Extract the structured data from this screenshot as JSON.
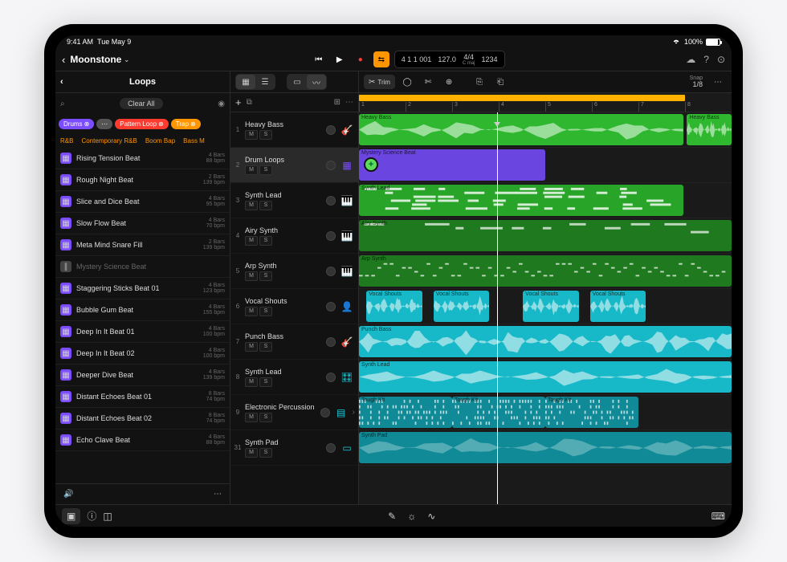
{
  "status": {
    "time": "9:41 AM",
    "date": "Tue May 9",
    "battery": "100%"
  },
  "project": {
    "title": "Moonstone"
  },
  "transport": {
    "position": "4 1 1 001",
    "tempo": "127.0",
    "signature": "4/4",
    "key": "C maj",
    "beat_count": "1234"
  },
  "snap": {
    "label": "Snap",
    "value": "1/8"
  },
  "sidebar": {
    "title": "Loops",
    "clear": "Clear All",
    "filters": [
      {
        "label": "Drums",
        "color": "#7c4dff"
      },
      {
        "label": "Pattern Loop",
        "color": "#ff3b30"
      },
      {
        "label": "Trap",
        "color": "#ff9500"
      }
    ],
    "genres": [
      "R&B",
      "Contemporary R&B",
      "Boom Bap",
      "Bass M"
    ],
    "loops": [
      {
        "name": "Rising Tension Beat",
        "bars": "4 Bars",
        "bpm": "88 bpm",
        "type": "purple"
      },
      {
        "name": "Rough Night Beat",
        "bars": "2 Bars",
        "bpm": "139 bpm",
        "type": "purple"
      },
      {
        "name": "Slice and Dice Beat",
        "bars": "4 Bars",
        "bpm": "95 bpm",
        "type": "purple"
      },
      {
        "name": "Slow Flow Beat",
        "bars": "4 Bars",
        "bpm": "70 bpm",
        "type": "purple"
      },
      {
        "name": "Meta Mind Snare Fill",
        "bars": "2 Bars",
        "bpm": "139 bpm",
        "type": "purple"
      },
      {
        "name": "Mystery Science Beat",
        "bars": "",
        "bpm": "",
        "type": "grey"
      },
      {
        "name": "Staggering Sticks Beat 01",
        "bars": "4 Bars",
        "bpm": "123 bpm",
        "type": "purple"
      },
      {
        "name": "Bubble Gum Beat",
        "bars": "4 Bars",
        "bpm": "155 bpm",
        "type": "purple"
      },
      {
        "name": "Deep In It Beat 01",
        "bars": "4 Bars",
        "bpm": "100 bpm",
        "type": "purple"
      },
      {
        "name": "Deep In It Beat 02",
        "bars": "4 Bars",
        "bpm": "100 bpm",
        "type": "purple"
      },
      {
        "name": "Deeper Dive Beat",
        "bars": "4 Bars",
        "bpm": "139 bpm",
        "type": "purple"
      },
      {
        "name": "Distant Echoes Beat 01",
        "bars": "8 Bars",
        "bpm": "74 bpm",
        "type": "purple"
      },
      {
        "name": "Distant Echoes Beat 02",
        "bars": "8 Bars",
        "bpm": "74 bpm",
        "type": "purple"
      },
      {
        "name": "Echo Clave Beat",
        "bars": "4 Bars",
        "bpm": "88 bpm",
        "type": "purple"
      }
    ]
  },
  "tracks": [
    {
      "num": "1",
      "name": "Heavy Bass",
      "color": "#3dd43d",
      "icon": "guitar"
    },
    {
      "num": "2",
      "name": "Drum Loops",
      "color": "#7c4dff",
      "icon": "drum-machine",
      "selected": true
    },
    {
      "num": "3",
      "name": "Synth Lead",
      "color": "#3dd43d",
      "icon": "keyboard"
    },
    {
      "num": "4",
      "name": "Airy Synth",
      "color": "#3dd43d",
      "icon": "keyboard"
    },
    {
      "num": "5",
      "name": "Arp Synth",
      "color": "#3dd43d",
      "icon": "keyboard"
    },
    {
      "num": "6",
      "name": "Vocal Shouts",
      "color": "#1ec9d9",
      "icon": "vocal"
    },
    {
      "num": "7",
      "name": "Punch Bass",
      "color": "#1ec9d9",
      "icon": "bass"
    },
    {
      "num": "8",
      "name": "Synth Lead",
      "color": "#1ec9d9",
      "icon": "synth"
    },
    {
      "num": "9",
      "name": "Electronic Percussion",
      "color": "#1ec9d9",
      "icon": "percussion",
      "expand": true
    },
    {
      "num": "31",
      "name": "Synth Pad",
      "color": "#1ec9d9",
      "icon": "pad"
    }
  ],
  "ms": {
    "m": "M",
    "s": "S"
  },
  "timeline": {
    "bars": [
      "1",
      "2",
      "3",
      "4",
      "5",
      "6",
      "7",
      "8"
    ],
    "cycle": {
      "start": 0,
      "end": 87.5
    },
    "playhead": 37,
    "lanes": [
      {
        "regions": [
          {
            "label": "Heavy Bass",
            "start": 0,
            "end": 87,
            "color": "#2fb82f",
            "kind": "audio"
          },
          {
            "label": "Heavy Bass",
            "start": 88,
            "end": 100,
            "color": "#2fb82f",
            "kind": "audio"
          }
        ]
      },
      {
        "regions": [
          {
            "label": "Mystery Science Beat",
            "start": 0,
            "end": 50,
            "color": "#6b45e0",
            "kind": "pattern"
          }
        ],
        "addbadge": true
      },
      {
        "regions": [
          {
            "label": "Synth Lead",
            "start": 0,
            "end": 87,
            "color": "#28a428",
            "kind": "midi"
          }
        ]
      },
      {
        "regions": [
          {
            "label": "Airy Synth",
            "start": 0,
            "end": 100,
            "color": "#1f7a1f",
            "kind": "midi-sparse"
          }
        ]
      },
      {
        "regions": [
          {
            "label": "Arp Synth",
            "start": 0,
            "end": 100,
            "color": "#1f7a1f",
            "kind": "midi-dots"
          }
        ]
      },
      {
        "regions": [
          {
            "label": "Vocal Shouts",
            "start": 2,
            "end": 17,
            "color": "#17b8c7",
            "kind": "audio"
          },
          {
            "label": "Vocal Shouts",
            "start": 20,
            "end": 35,
            "color": "#17b8c7",
            "kind": "audio"
          },
          {
            "label": "Vocal Shouts",
            "start": 44,
            "end": 59,
            "color": "#17b8c7",
            "kind": "audio"
          },
          {
            "label": "Vocal Shouts",
            "start": 62,
            "end": 77,
            "color": "#17b8c7",
            "kind": "audio"
          }
        ]
      },
      {
        "regions": [
          {
            "label": "Punch Bass",
            "start": 0,
            "end": 100,
            "color": "#17b8c7",
            "kind": "audio-dense"
          }
        ]
      },
      {
        "regions": [
          {
            "label": "Synth Lead",
            "start": 0,
            "end": 100,
            "color": "#17b8c7",
            "kind": "audio"
          }
        ]
      },
      {
        "regions": [
          {
            "label": "Tough Kit",
            "start": 0,
            "end": 25,
            "color": "#0f8a96",
            "kind": "drums"
          },
          {
            "label": "Tough Kit",
            "start": 25,
            "end": 50,
            "color": "#0f8a96",
            "kind": "drums"
          },
          {
            "label": "Tough Kit",
            "start": 50,
            "end": 75,
            "color": "#0f8a96",
            "kind": "drums"
          }
        ]
      },
      {
        "regions": [
          {
            "label": "Synth Pad",
            "start": 0,
            "end": 100,
            "color": "#0f8a96",
            "kind": "pad"
          }
        ]
      }
    ]
  },
  "toolbar": {
    "trim": "Trim"
  }
}
